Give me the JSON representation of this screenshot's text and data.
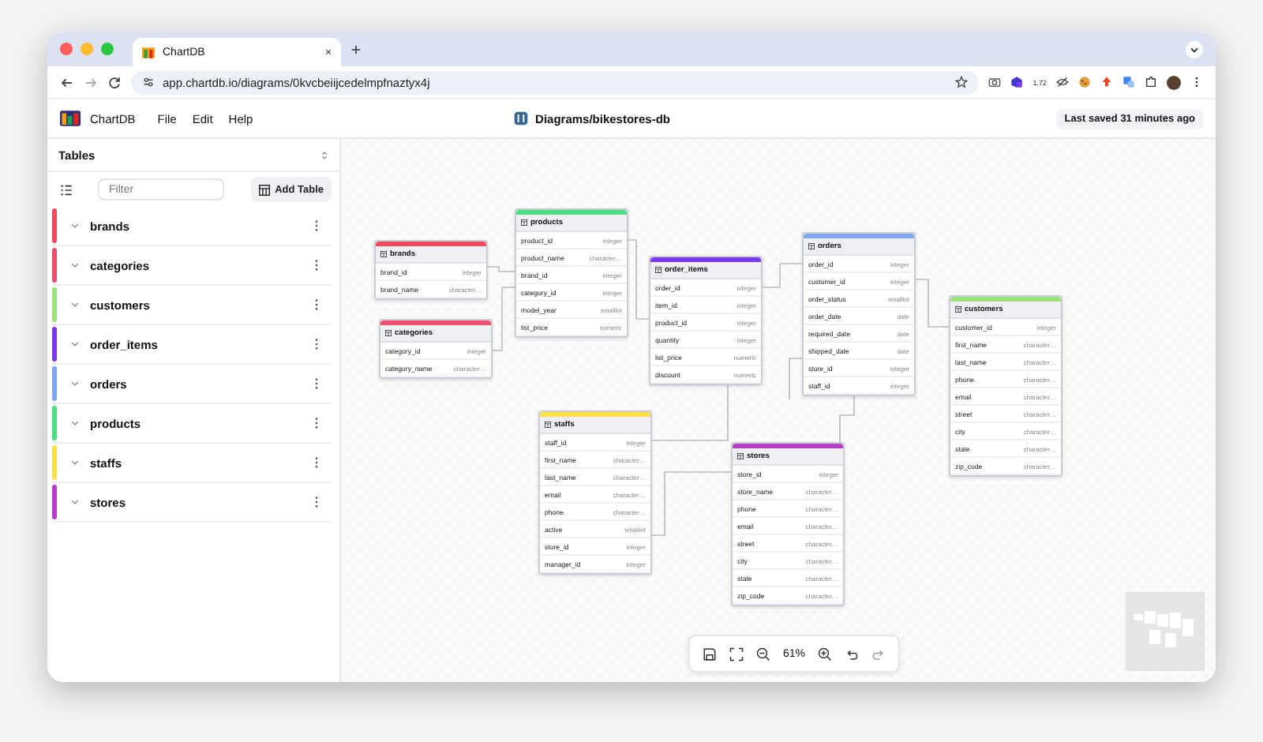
{
  "browser": {
    "tab_title": "ChartDB",
    "url": "app.chartdb.io/diagrams/0kvcbeiijcedelmpfnaztyx4j",
    "extension_badge": "1.72"
  },
  "app": {
    "logo_text": "ChartDB",
    "menu": [
      "File",
      "Edit",
      "Help"
    ],
    "diagram_title": "Diagrams/bikestores-db",
    "last_saved": "Last saved 31 minutes ago"
  },
  "sidebar": {
    "title": "Tables",
    "filter_placeholder": "Filter",
    "add_table": "Add Table",
    "tables": [
      {
        "name": "brands",
        "color": "#ef4b5f"
      },
      {
        "name": "categories",
        "color": "#ec4f6d"
      },
      {
        "name": "customers",
        "color": "#9be27a"
      },
      {
        "name": "order_items",
        "color": "#7c3aed"
      },
      {
        "name": "orders",
        "color": "#7ea7ef"
      },
      {
        "name": "products",
        "color": "#4ade80"
      },
      {
        "name": "staffs",
        "color": "#fde047"
      },
      {
        "name": "stores",
        "color": "#b93fc8"
      }
    ]
  },
  "canvas": {
    "zoom": "61%",
    "tables": [
      {
        "name": "brands",
        "color": "#ef4b5f",
        "columns": [
          {
            "name": "brand_id",
            "type": "integer"
          },
          {
            "name": "brand_name",
            "type": "character…"
          }
        ]
      },
      {
        "name": "categories",
        "color": "#ec4f6d",
        "columns": [
          {
            "name": "category_id",
            "type": "integer"
          },
          {
            "name": "category_name",
            "type": "character…"
          }
        ]
      },
      {
        "name": "products",
        "color": "#4ade80",
        "columns": [
          {
            "name": "product_id",
            "type": "integer"
          },
          {
            "name": "product_name",
            "type": "character…"
          },
          {
            "name": "brand_id",
            "type": "integer"
          },
          {
            "name": "category_id",
            "type": "integer"
          },
          {
            "name": "model_year",
            "type": "smallint"
          },
          {
            "name": "list_price",
            "type": "numeric"
          }
        ]
      },
      {
        "name": "order_items",
        "color": "#7c3aed",
        "columns": [
          {
            "name": "order_id",
            "type": "integer"
          },
          {
            "name": "item_id",
            "type": "integer"
          },
          {
            "name": "product_id",
            "type": "integer"
          },
          {
            "name": "quantity",
            "type": "integer"
          },
          {
            "name": "list_price",
            "type": "numeric"
          },
          {
            "name": "discount",
            "type": "numeric"
          }
        ]
      },
      {
        "name": "orders",
        "color": "#7ea7ef",
        "columns": [
          {
            "name": "order_id",
            "type": "integer"
          },
          {
            "name": "customer_id",
            "type": "integer"
          },
          {
            "name": "order_status",
            "type": "smallint"
          },
          {
            "name": "order_date",
            "type": "date"
          },
          {
            "name": "required_date",
            "type": "date"
          },
          {
            "name": "shipped_date",
            "type": "date"
          },
          {
            "name": "store_id",
            "type": "integer"
          },
          {
            "name": "staff_id",
            "type": "integer"
          }
        ]
      },
      {
        "name": "customers",
        "color": "#9be27a",
        "columns": [
          {
            "name": "customer_id",
            "type": "integer"
          },
          {
            "name": "first_name",
            "type": "character…"
          },
          {
            "name": "last_name",
            "type": "character…"
          },
          {
            "name": "phone",
            "type": "character…"
          },
          {
            "name": "email",
            "type": "character…"
          },
          {
            "name": "street",
            "type": "character…"
          },
          {
            "name": "city",
            "type": "character…"
          },
          {
            "name": "state",
            "type": "character…"
          },
          {
            "name": "zip_code",
            "type": "character…"
          }
        ]
      },
      {
        "name": "staffs",
        "color": "#fde047",
        "columns": [
          {
            "name": "staff_id",
            "type": "integer"
          },
          {
            "name": "first_name",
            "type": "character…"
          },
          {
            "name": "last_name",
            "type": "character…"
          },
          {
            "name": "email",
            "type": "character…"
          },
          {
            "name": "phone",
            "type": "character…"
          },
          {
            "name": "active",
            "type": "smallint"
          },
          {
            "name": "store_id",
            "type": "integer"
          },
          {
            "name": "manager_id",
            "type": "integer"
          }
        ]
      },
      {
        "name": "stores",
        "color": "#b93fc8",
        "columns": [
          {
            "name": "store_id",
            "type": "integer"
          },
          {
            "name": "store_name",
            "type": "character…"
          },
          {
            "name": "phone",
            "type": "character…"
          },
          {
            "name": "email",
            "type": "character…"
          },
          {
            "name": "street",
            "type": "character…"
          },
          {
            "name": "city",
            "type": "character…"
          },
          {
            "name": "state",
            "type": "character…"
          },
          {
            "name": "zip_code",
            "type": "character…"
          }
        ]
      }
    ]
  }
}
